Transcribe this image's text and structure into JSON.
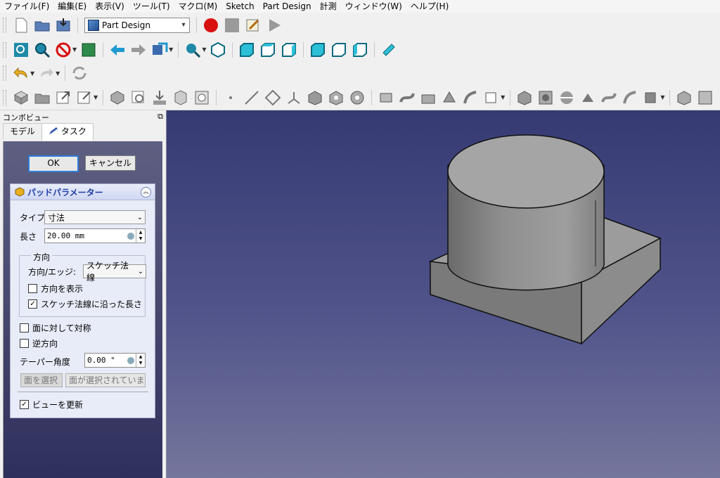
{
  "menu": [
    "ファイル(F)",
    "編集(E)",
    "表示(V)",
    "ツール(T)",
    "マクロ(M)",
    "Sketch",
    "Part Design",
    "計測",
    "ウィンドウ(W)",
    "ヘルプ(H)"
  ],
  "toolbar": {
    "workbench": "Part Design"
  },
  "combo_view": {
    "title": "コンボビュー",
    "float_icon": "⧉",
    "tabs": [
      "モデル",
      "タスク"
    ]
  },
  "task": {
    "ok": "OK",
    "cancel": "キャンセル",
    "panel_title": "パッドパラメーター",
    "type_label": "タイプ",
    "type_value": "寸法",
    "length_label": "長さ",
    "length_value": "20.00 mm",
    "direction_group": "方向",
    "direction_edge_label": "方向/エッジ:",
    "direction_edge_value": "スケッチ法線",
    "show_direction": "方向を表示",
    "show_direction_checked": false,
    "along_normal": "スケッチ法線に沿った長さ",
    "along_normal_checked": true,
    "symmetric": "面に対して対称",
    "symmetric_checked": false,
    "reversed": "逆方向",
    "reversed_checked": false,
    "taper_label": "テーパー角度",
    "taper_value": "0.00 °",
    "select_face": "面を選択",
    "no_face": "面が選択されていま…",
    "update_view": "ビューを更新",
    "update_view_checked": true
  },
  "colors": {
    "view_top": "#363a73",
    "view_bottom": "#75769c",
    "model_grey": "#8a8a8a",
    "panel_title": "#1f3fa8"
  }
}
